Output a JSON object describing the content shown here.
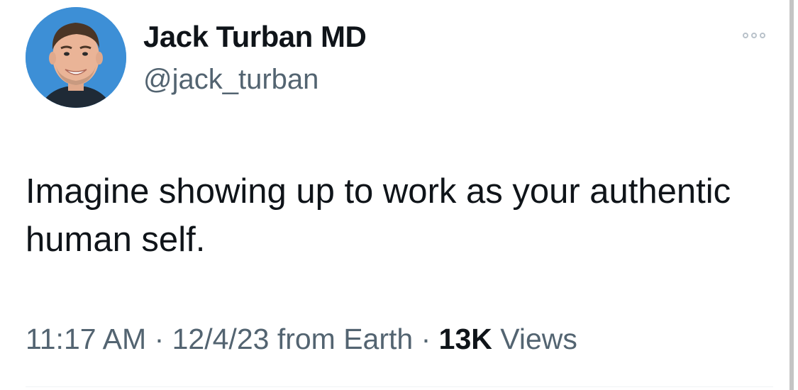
{
  "author": {
    "display_name": "Jack Turban MD",
    "handle": "@jack_turban",
    "avatar_icon": "profile-photo"
  },
  "menu": {
    "more_icon": "more-horizontal-icon"
  },
  "tweet": {
    "text": "Imagine showing up to work as your authentic human self."
  },
  "meta": {
    "time": "11:17 AM",
    "sep1": " · ",
    "date": "12/4/23",
    "source": " from Earth",
    "sep2": " · ",
    "views_count": "13K",
    "views_label": " Views"
  },
  "colors": {
    "text_primary": "#0f1419",
    "text_secondary": "#536471",
    "avatar_bg": "#3d8fd6"
  }
}
